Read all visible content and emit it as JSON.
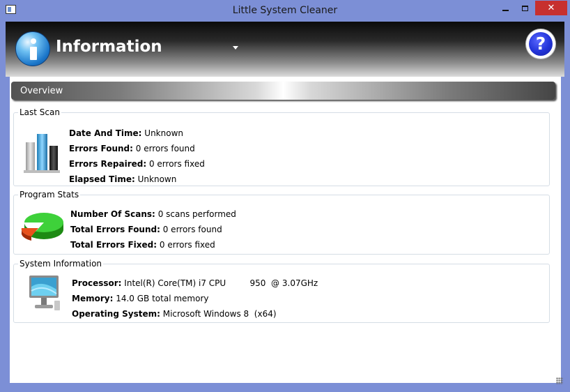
{
  "window": {
    "title": "Little System Cleaner",
    "close_glyph": "✕"
  },
  "header": {
    "title": "Information",
    "help_glyph": "?",
    "info_icon": "info-icon",
    "help_icon": "help-icon"
  },
  "overview": {
    "label": "Overview"
  },
  "last_scan": {
    "legend": "Last Scan",
    "rows": [
      {
        "label": "Date And Time:",
        "value": "Unknown"
      },
      {
        "label": "Errors Found:",
        "value": "0 errors found"
      },
      {
        "label": "Errors Repaired:",
        "value": "0 errors fixed"
      },
      {
        "label": "Elapsed Time:",
        "value": "Unknown"
      }
    ]
  },
  "program_stats": {
    "legend": "Program Stats",
    "rows": [
      {
        "label": "Number Of Scans:",
        "value": "0 scans performed"
      },
      {
        "label": "Total Errors Found:",
        "value": "0 errors found"
      },
      {
        "label": "Total Errors Fixed:",
        "value": "0 errors fixed"
      }
    ]
  },
  "system_info": {
    "legend": "System Information",
    "rows": [
      {
        "label": "Processor:",
        "value": "Intel(R) Core(TM) i7 CPU         950  @ 3.07GHz"
      },
      {
        "label": "Memory:",
        "value": "14.0 GB total memory"
      },
      {
        "label": "Operating System:",
        "value": "Microsoft Windows 8  (x64)"
      }
    ]
  },
  "colors": {
    "window_frame": "#7c8fd6",
    "close_button": "#c7302e",
    "info_blue": "#1b76c9",
    "help_blue": "#2233d8"
  }
}
